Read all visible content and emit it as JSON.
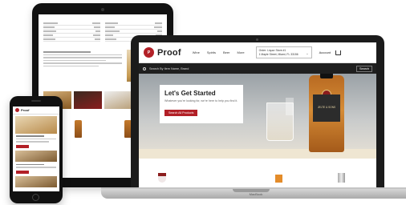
{
  "site": {
    "brand": "Proof",
    "logo_text": "P",
    "nav": [
      "Wine",
      "Spirits",
      "Beer",
      "More"
    ],
    "store_line1": "Order: Liquor Store #1",
    "store_line2": "1 Maple Street, Miami, FL 33156",
    "account_label": "Account",
    "search_placeholder": "Search By Item Name, Brand",
    "search_button": "Search",
    "hero_title": "Let's Get Started",
    "hero_subtitle": "Whatever you're looking for, we're here to help you find it.",
    "hero_cta": "Search All Products",
    "bottle_label": "JELTE & SONS"
  },
  "laptop": {
    "base_label": "MacBook"
  },
  "colors": {
    "accent": "#b22027",
    "dark_bar": "#1f1f1f"
  }
}
